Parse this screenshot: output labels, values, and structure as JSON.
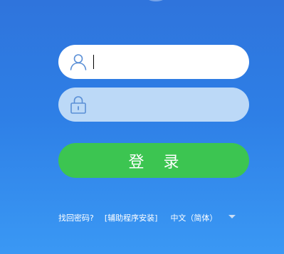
{
  "login": {
    "username": {
      "icon": "user-icon",
      "value": "",
      "placeholder": ""
    },
    "password": {
      "icon": "lock-icon",
      "value": "",
      "placeholder": ""
    },
    "submit_label": "登 录"
  },
  "footer": {
    "forgot_password": "找回密码?",
    "helper_install": "[辅助程序安装]",
    "language": "中文（简体）",
    "language_dropdown_icon": "chevron-down-icon"
  },
  "colors": {
    "background_top": "#2f74dc",
    "background_bottom": "#3a98f4",
    "login_button": "#3cc551",
    "username_field": "#ffffff",
    "password_field": "#bcd9f7",
    "icon_stroke": "#5a8fd6"
  }
}
